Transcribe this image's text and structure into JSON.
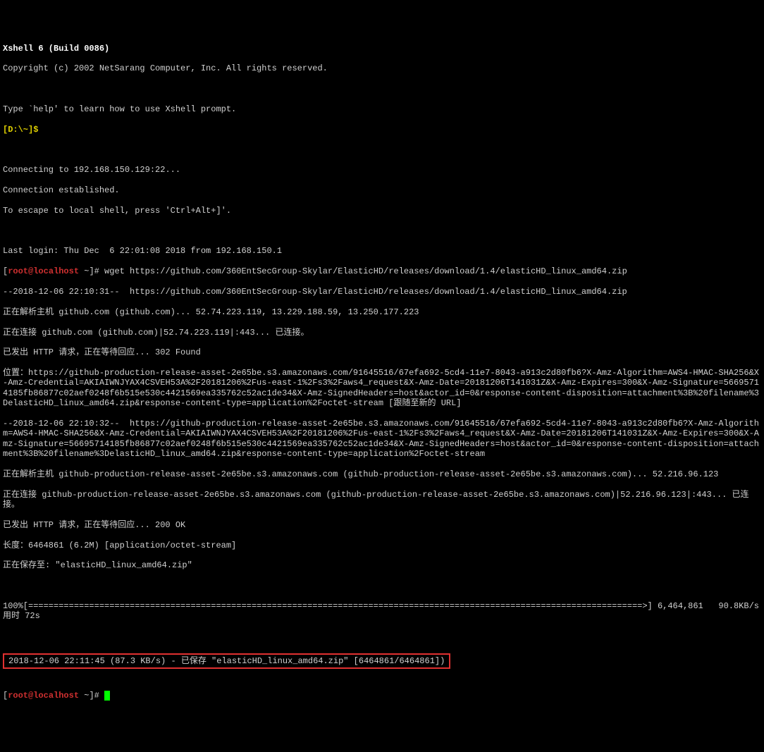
{
  "header": {
    "title": "Xshell 6 (Build 0086)",
    "copyright": "Copyright (c) 2002 NetSarang Computer, Inc. All rights reserved.",
    "helpLine": "Type `help' to learn how to use Xshell prompt.",
    "promptPath": "[D:\\~]",
    "promptSymbol": "$"
  },
  "connect": {
    "connecting": "Connecting to 192.168.150.129:22...",
    "established": "Connection established.",
    "escape": "To escape to local shell, press 'Ctrl+Alt+]'."
  },
  "session": {
    "lastLogin": "Last login: Thu Dec  6 22:01:08 2018 from 192.168.150.1",
    "promptUserHost": "root@localhost",
    "promptDir": "~",
    "promptHash": "#",
    "wgetCmd": "wget https://github.com/360EntSecGroup-Skylar/ElasticHD/releases/download/1.4/elasticHD_linux_amd64.zip"
  },
  "output": {
    "ts1": "--2018-12-06 22:10:31--  https://github.com/360EntSecGroup-Skylar/ElasticHD/releases/download/1.4/elasticHD_linux_amd64.zip",
    "resolve1": "正在解析主机 github.com (github.com)... 52.74.223.119, 13.229.188.59, 13.250.177.223",
    "connect1": "正在连接 github.com (github.com)|52.74.223.119|:443... 已连接。",
    "httpReq1": "已发出 HTTP 请求，正在等待回应... 302 Found",
    "locationLabel": "位置：",
    "locationUrl": "https://github-production-release-asset-2e65be.s3.amazonaws.com/91645516/67efa692-5cd4-11e7-8043-a913c2d80fb6?X-Amz-Algorithm=AWS4-HMAC-SHA256&X-Amz-Credential=AKIAIWNJYAX4CSVEH53A%2F20181206%2Fus-east-1%2Fs3%2Faws4_request&X-Amz-Date=20181206T141031Z&X-Amz-Expires=300&X-Amz-Signature=56695714185fb86877c02aef0248f6b515e530c4421569ea335762c52ac1de34&X-Amz-SignedHeaders=host&actor_id=0&response-content-disposition=attachment%3B%20filename%3DelasticHD_linux_amd64.zip&response-content-type=application%2Foctet-stream [跟随至新的 URL]",
    "ts2": "--2018-12-06 22:10:32--  https://github-production-release-asset-2e65be.s3.amazonaws.com/91645516/67efa692-5cd4-11e7-8043-a913c2d80fb6?X-Amz-Algorithm=AWS4-HMAC-SHA256&X-Amz-Credential=AKIAIWNJYAX4CSVEH53A%2F20181206%2Fus-east-1%2Fs3%2Faws4_request&X-Amz-Date=20181206T141031Z&X-Amz-Expires=300&X-Amz-Signature=56695714185fb86877c02aef0248f6b515e530c4421569ea335762c52ac1de34&X-Amz-SignedHeaders=host&actor_id=0&response-content-disposition=attachment%3B%20filename%3DelasticHD_linux_amd64.zip&response-content-type=application%2Foctet-stream",
    "resolve2": "正在解析主机 github-production-release-asset-2e65be.s3.amazonaws.com (github-production-release-asset-2e65be.s3.amazonaws.com)... 52.216.96.123",
    "connect2": "正在连接 github-production-release-asset-2e65be.s3.amazonaws.com (github-production-release-asset-2e65be.s3.amazonaws.com)|52.216.96.123|:443... 已连接。",
    "httpReq2": "已发出 HTTP 请求，正在等待回应... 200 OK",
    "length": "长度：6464861 (6.2M) [application/octet-stream]",
    "saving": "正在保存至: \"elasticHD_linux_amd64.zip\"",
    "progressLine": "100%[=========================================================================================================================>] 6,464,861   90.8KB/s 用时 72s",
    "finalLine": "2018-12-06 22:11:45 (87.3 KB/s) - 已保存 \"elasticHD_linux_amd64.zip\" [6464861/6464861])"
  }
}
